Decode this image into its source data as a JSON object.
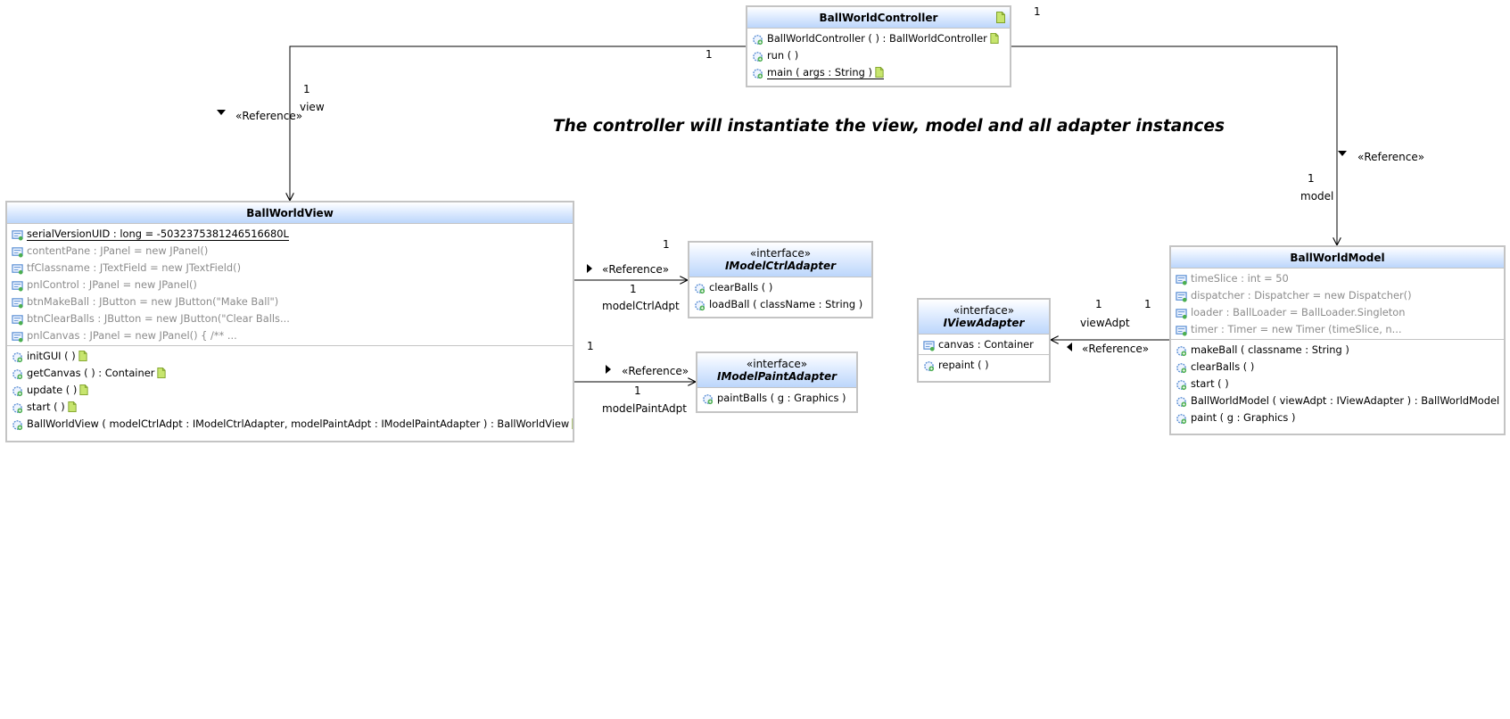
{
  "caption": "The controller will instantiate the view, model and all adapter instances",
  "controller": {
    "name": "BallWorldController",
    "operations": [
      {
        "text": "BallWorldController ( ) :  BallWorldController",
        "note": true
      },
      {
        "text": "run ( )",
        "note": false
      },
      {
        "text": "main ( args : String )",
        "note": true,
        "underline": true
      }
    ]
  },
  "view": {
    "name": "BallWorldView",
    "attributes": [
      {
        "text": "serialVersionUID : long = -5032375381246516680L",
        "underline": true,
        "gray": false
      },
      {
        "text": "contentPane : JPanel = new JPanel()",
        "gray": true
      },
      {
        "text": "tfClassname : JTextField = new JTextField()",
        "gray": true
      },
      {
        "text": "pnlControl : JPanel = new JPanel()",
        "gray": true
      },
      {
        "text": "btnMakeBall : JButton = new JButton(\"Make Ball\")",
        "gray": true
      },
      {
        "text": "btnClearBalls : JButton = new JButton(\"Clear Balls...",
        "gray": true
      },
      {
        "text": "pnlCanvas : JPanel = new JPanel() {    /**    ...",
        "gray": true
      }
    ],
    "operations": [
      {
        "text": "initGUI ( )",
        "note": true
      },
      {
        "text": "getCanvas ( ) :  Container",
        "note": true
      },
      {
        "text": "update ( )",
        "note": true
      },
      {
        "text": "start ( )",
        "note": true
      },
      {
        "text": "BallWorldView ( modelCtrlAdpt : IModelCtrlAdapter, modelPaintAdpt : IModelPaintAdapter ) :  BallWorldView",
        "note": true
      }
    ]
  },
  "ctrl_adapter": {
    "stereotype": "«interface»",
    "name": "IModelCtrlAdapter",
    "operations": [
      {
        "text": "clearBalls ( )"
      },
      {
        "text": "loadBall ( className : String )"
      }
    ]
  },
  "paint_adapter": {
    "stereotype": "«interface»",
    "name": "IModelPaintAdapter",
    "operations": [
      {
        "text": "paintBalls ( g : Graphics )"
      }
    ]
  },
  "view_adapter": {
    "stereotype": "«interface»",
    "name": "IViewAdapter",
    "attributes": [
      {
        "text": "canvas : Container"
      }
    ],
    "operations": [
      {
        "text": "repaint ( )"
      }
    ]
  },
  "model": {
    "name": "BallWorldModel",
    "attributes": [
      {
        "text": "timeSlice : int = 50",
        "gray": true
      },
      {
        "text": "dispatcher : Dispatcher = new Dispatcher()",
        "gray": true
      },
      {
        "text": "loader : BallLoader = BallLoader.Singleton",
        "gray": true
      },
      {
        "text": "timer : Timer = new  Timer (timeSlice, n...",
        "gray": true
      }
    ],
    "operations": [
      {
        "text": "makeBall ( classname : String )"
      },
      {
        "text": "clearBalls ( )"
      },
      {
        "text": "start ( )"
      },
      {
        "text": "BallWorldModel ( viewAdpt : IViewAdapter ) :  BallWorldModel"
      },
      {
        "text": "paint ( g : Graphics )"
      }
    ]
  },
  "associations": {
    "ctrl_view": {
      "source_mult": "1",
      "target_mult": "1",
      "role": "view",
      "stereotype": "«Reference»"
    },
    "ctrl_model": {
      "source_mult": "1",
      "target_mult": "1",
      "role": "model",
      "stereotype": "«Reference»"
    },
    "view_ctrladapter": {
      "source_mult": "1",
      "target_mult": "1",
      "role": "modelCtrlAdpt",
      "stereotype": "«Reference»"
    },
    "view_paintadapter": {
      "source_mult": "1",
      "target_mult": "1",
      "role": "modelPaintAdpt",
      "stereotype": "«Reference»"
    },
    "model_viewadapter": {
      "source_mult": "1",
      "target_mult": "1",
      "role": "viewAdpt",
      "stereotype": "«Reference»"
    }
  },
  "colors": {
    "header_top": "#ffffff",
    "header_bottom": "#bcd6fb",
    "border": "#c4c4c4",
    "gray_text": "#8c8c8c",
    "note_green": "#c7e56e",
    "icon_blue": "#5b8fd4"
  },
  "icons": {
    "attribute": "field-icon",
    "operation": "method-icon",
    "note": "note-icon"
  }
}
